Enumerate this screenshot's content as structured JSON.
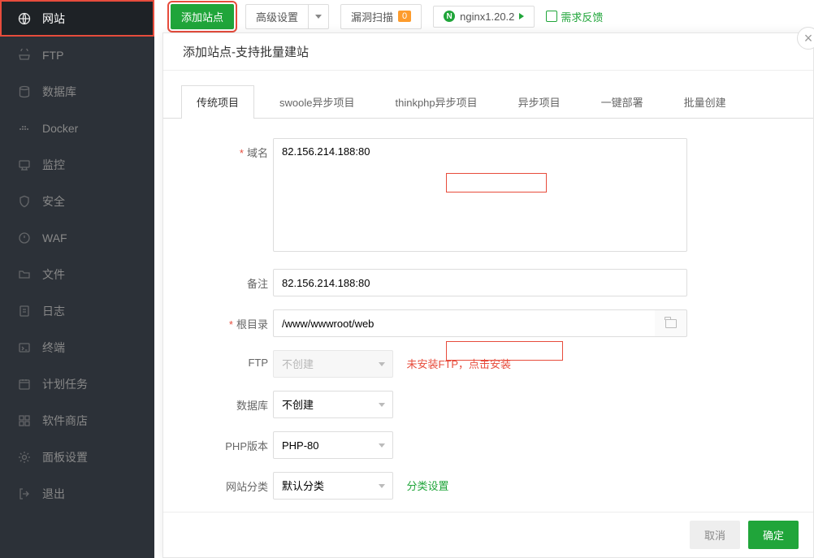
{
  "sidebar": {
    "items": [
      {
        "label": "网站",
        "icon": "globe"
      },
      {
        "label": "FTP",
        "icon": "ftp"
      },
      {
        "label": "数据库",
        "icon": "database"
      },
      {
        "label": "Docker",
        "icon": "docker"
      },
      {
        "label": "监控",
        "icon": "monitor"
      },
      {
        "label": "安全",
        "icon": "shield"
      },
      {
        "label": "WAF",
        "icon": "waf"
      },
      {
        "label": "文件",
        "icon": "folder"
      },
      {
        "label": "日志",
        "icon": "log"
      },
      {
        "label": "终端",
        "icon": "terminal"
      },
      {
        "label": "计划任务",
        "icon": "schedule"
      },
      {
        "label": "软件商店",
        "icon": "grid"
      },
      {
        "label": "面板设置",
        "icon": "gear"
      },
      {
        "label": "退出",
        "icon": "exit"
      }
    ]
  },
  "topbar": {
    "add_site": "添加站点",
    "advanced": "高级设置",
    "vuln_scan": "漏洞扫描",
    "vuln_count": "0",
    "nginx": "nginx1.20.2",
    "feedback": "需求反馈"
  },
  "modal": {
    "title": "添加站点-支持批量建站",
    "tabs": [
      "传统项目",
      "swoole异步项目",
      "thinkphp异步项目",
      "异步项目",
      "一键部署",
      "批量创建"
    ],
    "form": {
      "domain_label": "域名",
      "domain_value": "82.156.214.188:80",
      "remark_label": "备注",
      "remark_value": "82.156.214.188:80",
      "root_label": "根目录",
      "root_value": "/www/wwwroot/web",
      "ftp_label": "FTP",
      "ftp_value": "不创建",
      "ftp_hint": "未安装FTP，点击安装",
      "db_label": "数据库",
      "db_value": "不创建",
      "php_label": "PHP版本",
      "php_value": "PHP-80",
      "category_label": "网站分类",
      "category_value": "默认分类",
      "category_link": "分类设置"
    },
    "footer": {
      "cancel": "取消",
      "submit": "确定"
    }
  }
}
